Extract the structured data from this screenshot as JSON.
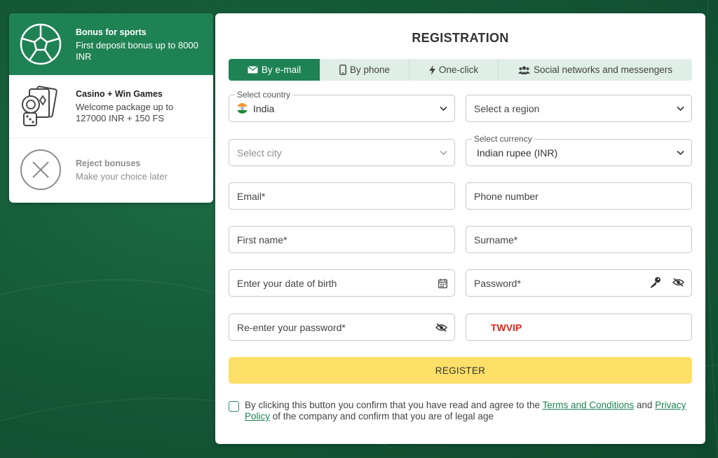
{
  "bonuses": [
    {
      "title": "Bonus for sports",
      "subtitle": "First deposit bonus up to 8000 INR",
      "icon": "soccer-ball-icon",
      "active": true
    },
    {
      "title": "Casino + Win Games",
      "subtitle": "Welcome package up to 127000 INR + 150 FS",
      "icon": "casino-cards-icon",
      "active": false
    },
    {
      "title": "Reject bonuses",
      "subtitle": "Make your choice later",
      "icon": "close-circle-icon",
      "active": false
    }
  ],
  "registration": {
    "title": "REGISTRATION",
    "tabs": [
      {
        "label": "By e-mail",
        "icon": "envelope-icon",
        "active": true
      },
      {
        "label": "By phone",
        "icon": "phone-icon",
        "active": false
      },
      {
        "label": "One-click",
        "icon": "lightning-icon",
        "active": false
      },
      {
        "label": "Social networks and messengers",
        "icon": "users-icon",
        "active": false
      }
    ],
    "country": {
      "label": "Select country",
      "value": "India"
    },
    "region": {
      "placeholder": "Select a region"
    },
    "city": {
      "placeholder": "Select city"
    },
    "currency": {
      "label": "Select currency",
      "value": "Indian rupee (INR)"
    },
    "email": {
      "placeholder": "Email*"
    },
    "phone": {
      "placeholder": "Phone number"
    },
    "first_name": {
      "placeholder": "First name*"
    },
    "surname": {
      "placeholder": "Surname*"
    },
    "dob": {
      "placeholder": "Enter your date of birth"
    },
    "password": {
      "placeholder": "Password*"
    },
    "repassword": {
      "placeholder": "Re-enter your password*"
    },
    "promo": {
      "value": "TWVIP"
    },
    "register_label": "REGISTER",
    "agree": {
      "prefix": "By clicking this button you confirm that you have read and agree to the ",
      "terms": "Terms and Conditions",
      "and": " and ",
      "privacy": "Privacy Policy",
      "suffix": " of the company and confirm that you are of legal age"
    }
  },
  "colors": {
    "brand_green": "#1f8255",
    "register_yellow": "#fedf67",
    "promo_red": "#e0261b"
  }
}
